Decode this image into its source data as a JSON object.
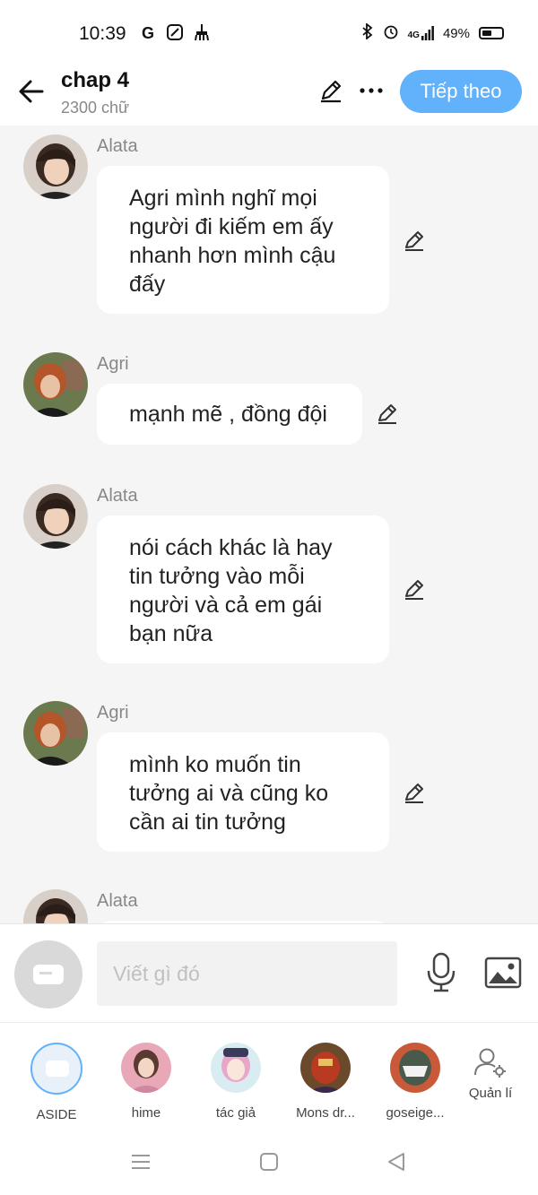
{
  "status_bar": {
    "time": "10:39",
    "signal_label": "4G",
    "battery_percent": "49%"
  },
  "header": {
    "title": "chap 4",
    "subtitle": "2300 chữ",
    "next_button": "Tiếp theo"
  },
  "messages": [
    {
      "sender": "Alata",
      "text": "Agri mình nghĩ mọi người đi kiếm em ấy nhanh hơn mình cậu đấy",
      "avatar": "alata"
    },
    {
      "sender": "Agri",
      "text": "mạnh mẽ , đồng đội",
      "avatar": "agri"
    },
    {
      "sender": "Alata",
      "text": "nói cách khác là hay tin tưởng vào mỗi người và cả em gái bạn nữa",
      "avatar": "alata"
    },
    {
      "sender": "Agri",
      "text": "mình ko muốn tin tưởng ai và cũng ko cần ai tin tưởng",
      "avatar": "agri"
    },
    {
      "sender": "Alata",
      "text": "",
      "avatar": "alata"
    }
  ],
  "input": {
    "placeholder": "Viết gì đó"
  },
  "characters": [
    {
      "label": "ASIDE"
    },
    {
      "label": "hime"
    },
    {
      "label": "tác giả"
    },
    {
      "label": "Mons dr..."
    },
    {
      "label": "goseige..."
    },
    {
      "label": "Quản lí"
    }
  ],
  "colors": {
    "accent": "#62b1fb",
    "background": "#f5f5f5",
    "bubble": "#ffffff"
  }
}
